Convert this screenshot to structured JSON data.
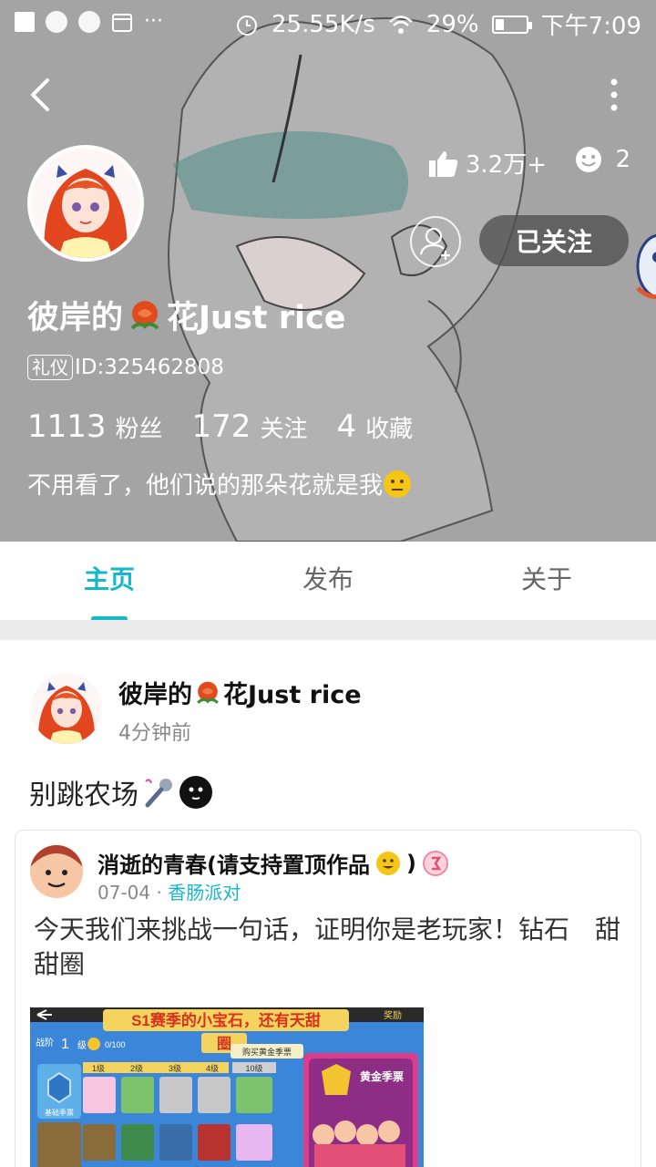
{
  "status_bar": {
    "network_speed": "25.55K/s",
    "battery": "29%",
    "battery_level": 0.29,
    "time": "下午7:09",
    "ellipsis": "···"
  },
  "profile": {
    "name_prefix": "彼岸的",
    "name_suffix": "花Just rice",
    "badge": "礼仪",
    "id_text": "ID:325462808",
    "likes": "3.2万+",
    "comments": "2",
    "follow_label": "已关注",
    "stats": [
      {
        "value": "1113",
        "label": "粉丝"
      },
      {
        "value": "172",
        "label": "关注"
      },
      {
        "value": "4",
        "label": "收藏"
      }
    ],
    "bio": "不用看了，他们说的那朵花就是我"
  },
  "tabs": [
    "主页",
    "发布",
    "关于"
  ],
  "post": {
    "author_prefix": "彼岸的",
    "author_suffix": "花Just rice",
    "time": "4分钟前",
    "text": "别跳农场",
    "repost": {
      "author": "消逝的青春(请支持置顶作品",
      "author_close": ")",
      "date": "07-04",
      "separator": "·",
      "topic": "香肠派对",
      "text": "今天我们来挑战一句话，证明你是老玩家！钻石　甜甜圈",
      "image_banner": "S1赛季的小宝石，还有天甜",
      "image_banner2": "圈",
      "image_reward": "奖励",
      "image_pass": "黄金季票",
      "image_buy": "购买黄金季票",
      "image_level": "1",
      "image_level_unit": "级",
      "image_progress": "0/100",
      "image_tiers": [
        "1级",
        "2级",
        "3级",
        "4级",
        "10级"
      ],
      "image_left_label": "基础季票",
      "image_top_label": "战阶"
    }
  },
  "colors": {
    "accent": "#16b8c8",
    "header_bg": "#a6a6a6",
    "follow_bg": "#505050"
  }
}
